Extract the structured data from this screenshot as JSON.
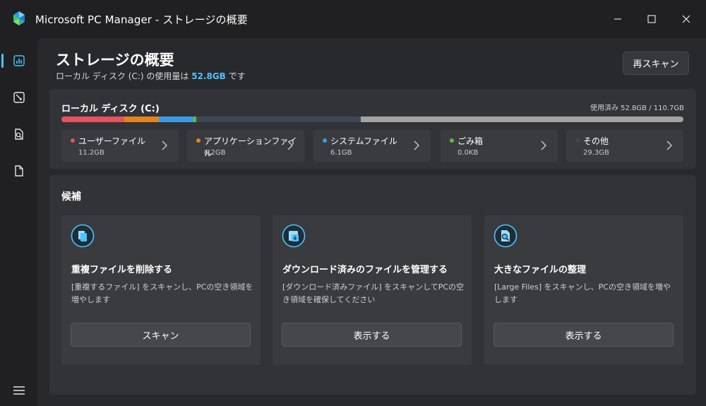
{
  "window": {
    "title": "Microsoft PC Manager - ストレージの概要",
    "controls": [
      "minimize-icon",
      "maximize-icon",
      "close-icon"
    ]
  },
  "sidebar": {
    "items": [
      {
        "icon": "storage-chart-icon",
        "active": true
      },
      {
        "icon": "cleanup-icon",
        "active": false
      },
      {
        "icon": "file-search-icon",
        "active": false
      },
      {
        "icon": "document-icon",
        "active": false
      }
    ],
    "menu_icon": "hamburger-menu-icon"
  },
  "header": {
    "title": "ストレージの概要",
    "subtitle_prefix": "ローカル ディスク (C:) の使用量は",
    "subtitle_value": "52.8GB",
    "subtitle_suffix": "です",
    "rescan_label": "再スキャン"
  },
  "disk": {
    "name": "ローカル ディスク (C:)",
    "usage_text": "使用済み 52.8GB / 110.7GB",
    "used_gb": 52.8,
    "total_gb": 110.7,
    "categories": [
      {
        "label": "ユーザーファイル",
        "size": "11.2GB",
        "gb": 11.2,
        "color": "#e5535f"
      },
      {
        "label": "アプリケーションファイル",
        "size": "6.2GB",
        "gb": 6.2,
        "color": "#e3851c"
      },
      {
        "label": "システムファイル",
        "size": "6.1GB",
        "gb": 6.1,
        "color": "#3b9be8"
      },
      {
        "label": "ごみ箱",
        "size": "0.0KB",
        "gb": 0.0,
        "color": "#5cbd3a"
      },
      {
        "label": "その他",
        "size": "29.3GB",
        "gb": 29.3,
        "color": "#3e4855"
      }
    ],
    "free_color": "#a3a3a3"
  },
  "suggestions": {
    "title": "候補",
    "cards": [
      {
        "icon": "duplicate-file-icon",
        "title": "重複ファイルを削除する",
        "desc": "[重複するファイル] をスキャンし、PCの空き領域を増やします",
        "button": "スキャン"
      },
      {
        "icon": "download-folder-icon",
        "title": "ダウンロード済みのファイルを管理する",
        "desc": "[ダウンロード済みファイル] をスキャンしてPCの空き領域を確保してください",
        "button": "表示する"
      },
      {
        "icon": "large-file-icon",
        "title": "大きなファイルの整理",
        "desc": "[Large Files] をスキャンし、PCの空き領域を増やします",
        "button": "表示する"
      }
    ]
  },
  "colors": {
    "accent": "#4cc2ff",
    "background": "#202022",
    "panel": "#28292c",
    "card": "#323337"
  }
}
